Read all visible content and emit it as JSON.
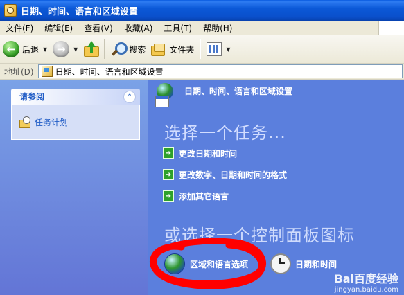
{
  "window": {
    "title": "日期、时间、语言和区域设置"
  },
  "menubar": {
    "items": [
      "文件(F)",
      "编辑(E)",
      "查看(V)",
      "收藏(A)",
      "工具(T)",
      "帮助(H)"
    ]
  },
  "toolbar": {
    "back_label": "后退",
    "search_label": "搜索",
    "folders_label": "文件夹"
  },
  "addressbar": {
    "label": "地址(D)",
    "value": "日期、时间、语言和区域设置"
  },
  "sidebar": {
    "panel_title": "请参阅",
    "links": [
      "任务计划"
    ]
  },
  "content": {
    "category_title": "日期、时间、语言和区域设置",
    "pick_task_heading": "选择一个任务...",
    "tasks": [
      "更改日期和时间",
      "更改数字、日期和时间的格式",
      "添加其它语言"
    ],
    "pick_icon_heading": "或选择一个控制面板图标",
    "control_panel_icons": [
      "区域和语言选项",
      "日期和时间"
    ]
  },
  "watermark": {
    "logo": "Bai百度经验",
    "url": "jingyan.baidu.com"
  },
  "colors": {
    "titlebar": "#0a50cc",
    "left_pane": "#7ba2e7",
    "right_pane": "#5b7fdd",
    "task_arrow": "#2ea12a",
    "annotation": "#ff0000"
  }
}
